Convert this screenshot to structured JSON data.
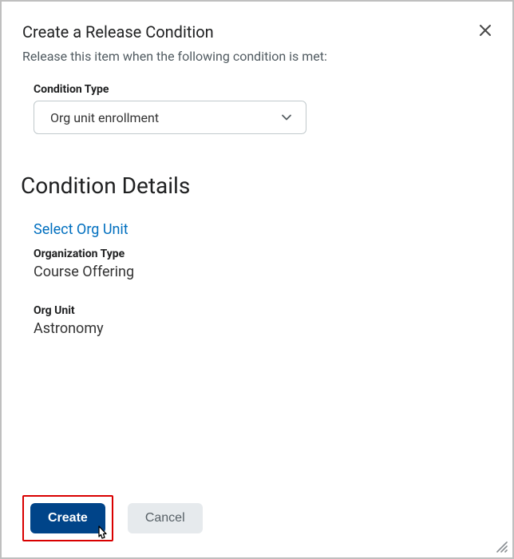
{
  "dialog": {
    "title": "Create a Release Condition",
    "description": "Release this item when the following condition is met:"
  },
  "conditionType": {
    "label": "Condition Type",
    "value": "Org unit enrollment"
  },
  "details": {
    "heading": "Condition Details",
    "selectLink": "Select Org Unit",
    "orgTypeLabel": "Organization Type",
    "orgTypeValue": "Course Offering",
    "orgUnitLabel": "Org Unit",
    "orgUnitValue": "Astronomy"
  },
  "actions": {
    "create": "Create",
    "cancel": "Cancel"
  }
}
